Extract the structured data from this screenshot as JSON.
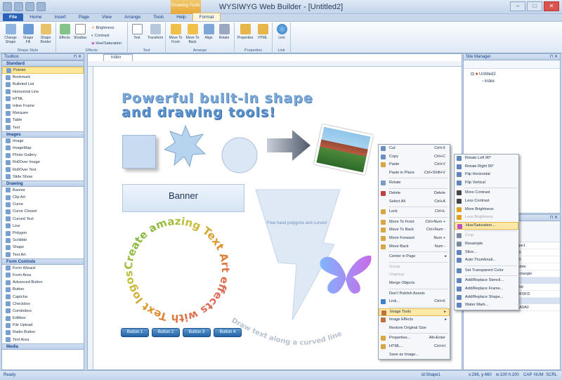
{
  "window": {
    "title": "WYSIWYG Web Builder - [Untitled2]",
    "context_tab": "Drawing Tools"
  },
  "ribbon_tabs": [
    "File",
    "Home",
    "Insert",
    "Page",
    "View",
    "Arrange",
    "Tools",
    "Help",
    "Format"
  ],
  "ribbon": {
    "groups": [
      "Shape Style",
      "Effects",
      "Text",
      "Arrange",
      "Properties",
      "Link"
    ],
    "buttons": [
      "Change Shape",
      "Shape Fill",
      "Shape Border",
      "Effects",
      "Shadow",
      "Text",
      "Transform",
      "Move To Front",
      "Move To Back",
      "Align",
      "Rotate",
      "Properties",
      "HTML",
      "Link"
    ],
    "small_buttons": [
      "Brightness",
      "Contrast",
      "Hue/Saturation"
    ]
  },
  "toolbox": {
    "title": "Toolbox",
    "categories": [
      {
        "name": "Standard",
        "items": [
          "Pointer",
          "Bookmark",
          "Bulleted List",
          "Horizontal Line",
          "HTML",
          "Inline Frame",
          "Marquee",
          "Table",
          "Text"
        ]
      },
      {
        "name": "Images",
        "items": [
          "Image",
          "ImageMap",
          "Photo Gallery",
          "RollOver Image",
          "RollOver Text",
          "Slide Show"
        ]
      },
      {
        "name": "Drawing",
        "items": [
          "Banner",
          "Clip Art",
          "Curve",
          "Curve Closed",
          "Curved Text",
          "Line",
          "Polygon",
          "Scribble",
          "Shape",
          "Text Art"
        ]
      },
      {
        "name": "Form Controls",
        "items": [
          "Form Wizard",
          "Form Area",
          "Advanced Button",
          "Button",
          "Captcha",
          "Checkbox",
          "Combobox",
          "Editbox",
          "File Upload",
          "Radio Button",
          "Text Area"
        ]
      },
      {
        "name": "Media",
        "items": []
      }
    ]
  },
  "editor": {
    "doc_tab": "index",
    "headline1": "Powerful built-in shape",
    "headline2": "and drawing tools!",
    "banner_text": "Banner",
    "polygon_text": "Free hand polygons and curves!",
    "circular_text": "Create amazing Text Art effects with Text logos",
    "curved_text": "Draw text along a curved line",
    "buttons": [
      "Button 1",
      "Button 2",
      "Button 3",
      "Button 4"
    ]
  },
  "site_manager": {
    "title": "Site Manager",
    "root": "Untitled2",
    "page": "index"
  },
  "properties": {
    "rows": [
      {
        "k": "",
        "v": "hape1"
      },
      {
        "k": "",
        "v": "460"
      },
      {
        "k": "",
        "v": "100"
      },
      {
        "k": "",
        "v": "Visible"
      },
      {
        "k": "Shape",
        "v": "Rectangle"
      }
    ],
    "cat_background": "Background",
    "bg_rows": [
      {
        "k": "Background M...",
        "v": "Solid"
      },
      {
        "k": "Background C...",
        "v": "FDFDFD"
      }
    ],
    "cat_border": "Border",
    "border_rows": [
      {
        "k": "Border Color",
        "v": "A9A9A0"
      }
    ]
  },
  "context_menu": [
    {
      "label": "Cut",
      "sc": "Ctrl+X"
    },
    {
      "label": "Copy",
      "sc": "Ctrl+C"
    },
    {
      "label": "Paste",
      "sc": "Ctrl+V"
    },
    {
      "label": "Paste in Place",
      "sc": "Ctrl+Shift+V"
    },
    {
      "label": "Rotate",
      "sc": ""
    },
    {
      "label": "Delete",
      "sc": "Delete"
    },
    {
      "label": "Select All",
      "sc": "Ctrl+A"
    },
    {
      "label": "Lock",
      "sc": "Ctrl+L"
    },
    {
      "label": "Move To Front",
      "sc": "Ctrl+Num +"
    },
    {
      "label": "Move To Back",
      "sc": "Ctrl+Num -"
    },
    {
      "label": "Move Forward",
      "sc": "Num +"
    },
    {
      "label": "Move Back",
      "sc": "Num -"
    },
    {
      "label": "Center in Page",
      "sc": ""
    },
    {
      "label": "Group",
      "sc": ""
    },
    {
      "label": "Ungroup",
      "sc": ""
    },
    {
      "label": "Merge Objects",
      "sc": ""
    },
    {
      "label": "Don't Publish Assets",
      "sc": ""
    },
    {
      "label": "Link...",
      "sc": "Ctrl+K"
    },
    {
      "label": "Image Tools",
      "sc": ""
    },
    {
      "label": "Image Effects",
      "sc": ""
    },
    {
      "label": "Restore Original Size",
      "sc": ""
    },
    {
      "label": "Properties...",
      "sc": "Alt+Enter"
    },
    {
      "label": "HTML...",
      "sc": "Ctrl+H"
    },
    {
      "label": "Save as Image...",
      "sc": ""
    }
  ],
  "submenu": [
    "Rotate Left 90°",
    "Rotate Right 90°",
    "Flip Horizontal",
    "Flip Vertical",
    "More Contrast",
    "Less Contrast",
    "More Brightness",
    "Less Brightness",
    "Hue/Saturation...",
    "Crop",
    "Resample",
    "Slice...",
    "Auto Thumbnail...",
    "Set Transparent Color",
    "Add/Replace Stencil...",
    "Add/Replace Frame...",
    "Add/Replace Shape...",
    "Water Mark..."
  ],
  "status": {
    "left": "Ready",
    "id": "id:Shape1",
    "coords": "x:296, y:460",
    "size": "w:100 h:100",
    "caps": "CAP",
    "num": "NUM",
    "scrl": "SCRL"
  }
}
